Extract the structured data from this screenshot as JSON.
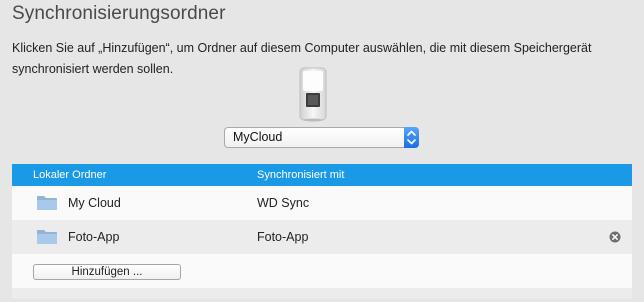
{
  "header": {
    "title": "Synchronisierungsordner"
  },
  "description": "Klicken Sie auf „Hinzufügen“, um Ordner auf diesem Computer auswählen, die mit diesem Speichergerät synchronisiert werden sollen.",
  "device_icon": "nas-device-icon",
  "device_select": {
    "selected": "MyCloud"
  },
  "table": {
    "columns": [
      "Lokaler Ordner",
      "Synchronisiert mit"
    ],
    "rows": [
      {
        "local_folder": "My Cloud",
        "synced_with": "WD Sync",
        "icon": "folder-icon",
        "removable": false
      },
      {
        "local_folder": "Foto-App",
        "synced_with": "Foto-App",
        "icon": "folder-icon",
        "removable": true
      }
    ],
    "add_button": "Hinzufügen ..."
  },
  "colors": {
    "header_blue": "#1a9ae6",
    "select_accent": "#1a6ee6",
    "background": "#e6e6e6"
  }
}
